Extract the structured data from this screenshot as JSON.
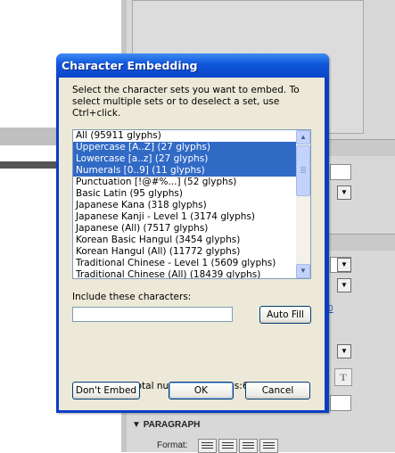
{
  "dialog": {
    "title": "Character Embedding",
    "instructions": "Select the character sets you want to embed. To select multiple sets or to deselect a set, use Ctrl+click.",
    "list_items": [
      {
        "label": "All  (95911 glyphs)",
        "selected": false
      },
      {
        "label": "Uppercase [A..Z]  (27 glyphs)",
        "selected": true
      },
      {
        "label": "Lowercase [a..z]  (27 glyphs)",
        "selected": true
      },
      {
        "label": "Numerals [0..9]  (11 glyphs)",
        "selected": true
      },
      {
        "label": "Punctuation [!@#%...]  (52 glyphs)",
        "selected": false
      },
      {
        "label": "Basic Latin  (95 glyphs)",
        "selected": false
      },
      {
        "label": "Japanese Kana  (318 glyphs)",
        "selected": false
      },
      {
        "label": "Japanese Kanji - Level 1 (3174 glyphs)",
        "selected": false
      },
      {
        "label": "Japanese (All)  (7517 glyphs)",
        "selected": false
      },
      {
        "label": "Korean Basic Hangul (3454 glyphs)",
        "selected": false
      },
      {
        "label": "Korean Hangul (All) (11772 glyphs)",
        "selected": false
      },
      {
        "label": "Traditional Chinese - Level 1 (5609 glyphs)",
        "selected": false
      },
      {
        "label": "Traditional Chinese (All)  (18439 glyphs)",
        "selected": false
      }
    ],
    "include_label": "Include these characters:",
    "include_value": "",
    "auto_fill_label": "Auto Fill",
    "total_label": "Total number of glyphs:",
    "total_value": "64",
    "dont_embed_label": "Don't Embed",
    "ok_label": "OK",
    "cancel_label": "Cancel"
  },
  "background": {
    "paragraph_header": "PARAGRAPH",
    "format_label": "Format:",
    "link_text": "0"
  },
  "colors": {
    "selection": "#316ac5",
    "titlebar": "#0a47c9",
    "dialog_face": "#ece9d8"
  }
}
